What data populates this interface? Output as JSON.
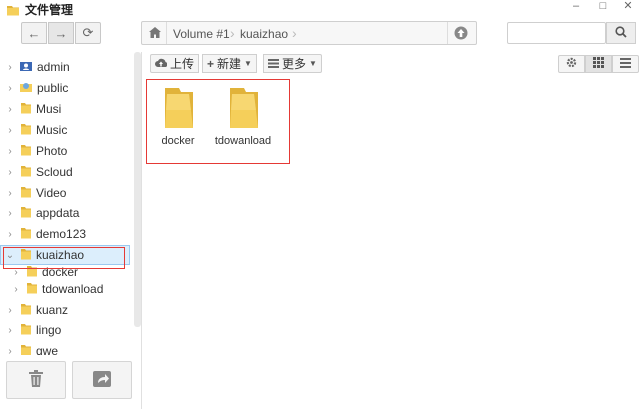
{
  "window": {
    "title": "文件管理",
    "controls": {
      "minimize": "–",
      "maximize": "□",
      "close": "✕"
    }
  },
  "nav": {
    "back": "←",
    "forward": "→",
    "refresh": "⟳"
  },
  "address": {
    "home_icon": "home-icon",
    "crumbs": [
      "Volume #1",
      "kuaizhao"
    ],
    "up_icon": "up-icon"
  },
  "search": {
    "placeholder": "",
    "value": ""
  },
  "toolbar": {
    "upload": "上传",
    "new": "新建",
    "more": "更多"
  },
  "sidebar": {
    "items": [
      {
        "label": "admin",
        "icon": "user-folder-icon",
        "expanded": false
      },
      {
        "label": "public",
        "icon": "public-folder-icon",
        "expanded": false
      },
      {
        "label": "Musi",
        "icon": "folder-icon",
        "expanded": false
      },
      {
        "label": "Music",
        "icon": "folder-icon",
        "expanded": false
      },
      {
        "label": "Photo",
        "icon": "folder-icon",
        "expanded": false
      },
      {
        "label": "Scloud",
        "icon": "folder-icon",
        "expanded": false
      },
      {
        "label": "Video",
        "icon": "folder-icon",
        "expanded": false
      },
      {
        "label": "appdata",
        "icon": "folder-icon",
        "expanded": false
      },
      {
        "label": "demo123",
        "icon": "folder-icon",
        "expanded": false
      },
      {
        "label": "kuaizhao",
        "icon": "folder-icon",
        "expanded": true,
        "selected": true
      },
      {
        "label": "docker",
        "icon": "folder-icon",
        "child": true
      },
      {
        "label": "tdowanload",
        "icon": "folder-icon",
        "child": true
      },
      {
        "label": "kuanz",
        "icon": "folder-icon",
        "expanded": false
      },
      {
        "label": "lingo",
        "icon": "folder-icon",
        "expanded": false
      },
      {
        "label": "qwe",
        "icon": "folder-icon",
        "expanded": false
      }
    ]
  },
  "content": {
    "items": [
      {
        "label": "docker",
        "icon": "folder-icon"
      },
      {
        "label": "tdowanload",
        "icon": "folder-icon"
      }
    ]
  },
  "colors": {
    "folder": "#f5cf5a",
    "folder_dark": "#e1b33a",
    "selection_bg": "#dceefc",
    "selection_border": "#9cc9ef",
    "highlight": "#e53935"
  }
}
